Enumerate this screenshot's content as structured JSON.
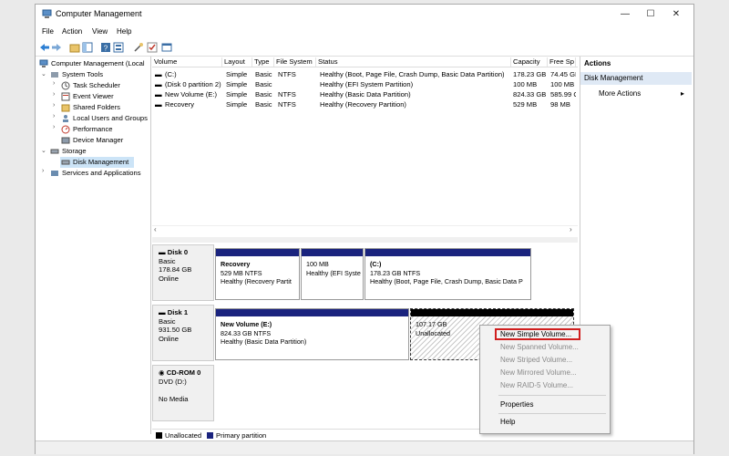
{
  "window": {
    "title": "Computer Management",
    "controls": {
      "minimize": "—",
      "maximize": "☐",
      "close": "✕"
    }
  },
  "menu": {
    "items": [
      "File",
      "Action",
      "View",
      "Help"
    ]
  },
  "toolbar": {
    "icons": [
      "back-icon",
      "forward-icon",
      "up-folder-icon",
      "show-hide-tree-icon",
      "help-icon",
      "properties-icon",
      "wizard-icon",
      "check-icon",
      "view-icon"
    ]
  },
  "tree": {
    "root": "Computer Management (Local",
    "system_tools": "System Tools",
    "task_scheduler": "Task Scheduler",
    "event_viewer": "Event Viewer",
    "shared_folders": "Shared Folders",
    "local_users": "Local Users and Groups",
    "performance": "Performance",
    "device_manager": "Device Manager",
    "storage": "Storage",
    "disk_management": "Disk Management",
    "services": "Services and Applications"
  },
  "volumes": {
    "headers": [
      "Volume",
      "Layout",
      "Type",
      "File System",
      "Status",
      "Capacity",
      "Free Sp"
    ],
    "rows": [
      {
        "volume": "(C:)",
        "layout": "Simple",
        "type": "Basic",
        "fs": "NTFS",
        "status": "Healthy (Boot, Page File, Crash Dump, Basic Data Partition)",
        "capacity": "178.23 GB",
        "free": "74.45 GI"
      },
      {
        "volume": "(Disk 0 partition 2)",
        "layout": "Simple",
        "type": "Basic",
        "fs": "",
        "status": "Healthy (EFI System Partition)",
        "capacity": "100 MB",
        "free": "100 MB"
      },
      {
        "volume": "New Volume (E:)",
        "layout": "Simple",
        "type": "Basic",
        "fs": "NTFS",
        "status": "Healthy (Basic Data Partition)",
        "capacity": "824.33 GB",
        "free": "585.99 C"
      },
      {
        "volume": "Recovery",
        "layout": "Simple",
        "type": "Basic",
        "fs": "NTFS",
        "status": "Healthy (Recovery Partition)",
        "capacity": "529 MB",
        "free": "98 MB"
      }
    ]
  },
  "disks": {
    "disk0": {
      "name": "Disk 0",
      "type": "Basic",
      "size": "178.84 GB",
      "state": "Online",
      "parts": [
        {
          "title": "Recovery",
          "size": "529 MB NTFS",
          "status": "Healthy (Recovery Partit"
        },
        {
          "title": "",
          "size": "100 MB",
          "status": "Healthy (EFI Syste"
        },
        {
          "title": "(C:)",
          "size": "178.23 GB NTFS",
          "status": "Healthy (Boot, Page File, Crash Dump, Basic Data P"
        }
      ]
    },
    "disk1": {
      "name": "Disk 1",
      "type": "Basic",
      "size": "931.50 GB",
      "state": "Online",
      "parts": [
        {
          "title": "New Volume  (E:)",
          "size": "824.33 GB NTFS",
          "status": "Healthy (Basic Data Partition)"
        },
        {
          "title": "",
          "size": "107.17 GB",
          "status": "Unallocated"
        }
      ]
    },
    "cdrom": {
      "name": "CD-ROM 0",
      "type": "DVD (D:)",
      "media": "No Media"
    }
  },
  "legend": {
    "unallocated": "Unallocated",
    "primary": "Primary partition",
    "unallocated_color": "#000000",
    "primary_color": "#1a237e"
  },
  "actions": {
    "header": "Actions",
    "section": "Disk Management",
    "more": "More Actions"
  },
  "context_menu": {
    "items": [
      {
        "label": "New Simple Volume...",
        "enabled": true
      },
      {
        "label": "New Spanned Volume...",
        "enabled": false
      },
      {
        "label": "New Striped Volume...",
        "enabled": false
      },
      {
        "label": "New Mirrored Volume...",
        "enabled": false
      },
      {
        "label": "New RAID-5 Volume...",
        "enabled": false
      },
      {
        "label": "Properties",
        "enabled": true
      },
      {
        "label": "Help",
        "enabled": true
      }
    ],
    "highlight_color": "#d01f1f"
  }
}
